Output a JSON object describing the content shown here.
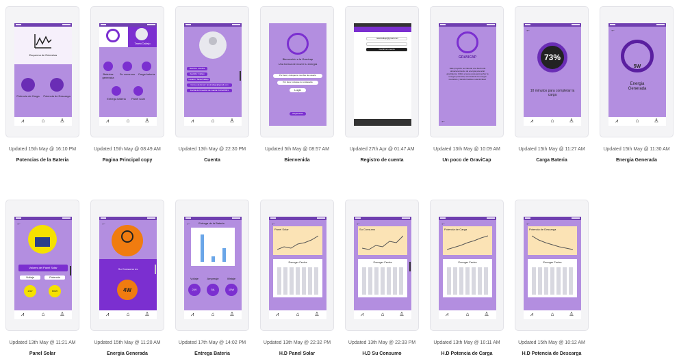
{
  "screens": [
    {
      "title": "Potencias de la Bateria",
      "updated": "Updated 15th May @ 16:10 PM"
    },
    {
      "title": "Pagina Principal copy",
      "updated": "Updated 15th May @ 08:49 AM"
    },
    {
      "title": "Cuenta",
      "updated": "Updated 13th May @ 22:30 PM"
    },
    {
      "title": "Bienvenida",
      "updated": "Updated 5th May @ 08:57 AM"
    },
    {
      "title": "Registro de cuenta",
      "updated": "Updated 27th Apr @ 01:47 AM"
    },
    {
      "title": "Un poco de GraviCap",
      "updated": "Updated 13th May @ 10:09 AM"
    },
    {
      "title": "Carga Bateria",
      "updated": "Updated 15th May @ 11:27 AM"
    },
    {
      "title": "Energia Generada",
      "updated": "Updated 15th May @ 11:30 AM"
    },
    {
      "title": "Panel Solar",
      "updated": "Updated 13th May @ 11:21 AM"
    },
    {
      "title": "Energia Generada",
      "updated": "Updated 15th May @ 11:20 AM"
    },
    {
      "title": "Entrega Bateria",
      "updated": "Updated 17th May @ 14:02 PM"
    },
    {
      "title": "H.D Panel Solar",
      "updated": "Updated 13th May @ 22:32 PM"
    },
    {
      "title": "H.D Su Consumo",
      "updated": "Updated 13th May @ 22:33 PM"
    },
    {
      "title": "H.D Potencia de Carga",
      "updated": "Updated 13th May @ 10:11 AM"
    },
    {
      "title": "H.D Potencia de Descarga",
      "updated": "Updated 15th May @ 10:12 AM"
    }
  ],
  "content": {
    "s1": {
      "header": "Esquema de Entereias",
      "btn1": "Potencia de Carga",
      "btn2": "Potencia de Descarga"
    },
    "s2": {
      "user": "Tarek/Callejo",
      "i1": "Baterías generada",
      "i2": "Su consumo",
      "i3": "Carga batería",
      "i4": "Entrega batería",
      "i5": "Panel solar"
    },
    "s3": {
      "f1": "Nombre: nombre",
      "f2": "Apellido: Callejo",
      "f3": "Usuario: Tarek/Callejo",
      "f4": "Correo de Email: tarekcallejo@gmail.com",
      "f5": "Fecha de Creación de cuenta: 10/12/2021"
    },
    "s4": {
      "welcome": "Bienvenido a la Gravicap",
      "tagline": "Una fuerza de mover tu energía",
      "opt1": "Por favor, coloque su nombre de usuario",
      "opt2": "Por favor, coloque tu contraseña",
      "login": "Login",
      "register": "Registrarse"
    },
    "s5": {
      "email": "tarekcallejo@gmail.com",
      "btn": "Confirmar cuenta"
    },
    "s6": {
      "brand": "GRAVICAP",
      "body": "Este proyecto se trata de una fuerza de almacenamiento de energía potencial gravitatoria. Utiliza el peso para aprovechar la energía potencial, acumulando la energía mecánica y transformarla en electricidad."
    },
    "s7": {
      "percent": "73%",
      "caption": "10 minutos para completar la carga"
    },
    "s8": {
      "value": "5W",
      "caption": "Energia Generada"
    },
    "s9": {
      "header": "Valores del Panel Solar",
      "b1": "Voltaje",
      "b2": "Potencia",
      "v1": "24V",
      "v2": "50W"
    },
    "s10": {
      "caption": "Su Consumo es",
      "value": "4W"
    },
    "s11": {
      "header": "Entrega de la Bateria",
      "k1": "Voltaje",
      "k2": "Amperaje",
      "k3": "Wataje",
      "v1": "24V",
      "v2": "5A",
      "v3": "15W"
    },
    "s12": {
      "chart": "Panel Solar",
      "calendar": "Escoger Fecha"
    },
    "s13": {
      "chart": "Su Consumo",
      "calendar": "Escoger Fecha"
    },
    "s14": {
      "chart": "Potencia de Carga",
      "calendar": "Escoger Fecha"
    },
    "s15": {
      "chart": "Potencia de Descarga",
      "calendar": "Escoger Fecha"
    }
  },
  "colors": {
    "phone_bg": "#b38ee0",
    "accent": "#7b2fd0",
    "yellow": "#f5e100",
    "orange": "#f07c10",
    "chart_bg": "#fbe3b5"
  }
}
